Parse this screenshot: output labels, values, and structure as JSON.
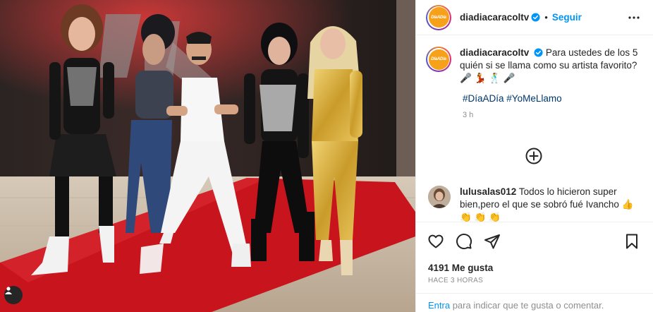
{
  "header": {
    "username": "diadiacaracoltv",
    "follow_label": "Seguir",
    "separator": "•",
    "logo_text": "DíaADía"
  },
  "caption": {
    "username": "diadiacaracoltv",
    "text": "Para ustedes de los 5 quién si se llama como su artista favorito? 🎤 💃 🕺 🎤",
    "hashtags": [
      "#DíaADía",
      "#YoMeLlamo"
    ],
    "time": "3 h"
  },
  "comment": {
    "username": "lulusalas012",
    "text": "Todos lo hicieron super bien,pero el que se sobró fué Ivancho 👍 👏 👏 👏"
  },
  "actions": {
    "likes": "4191 Me gusta",
    "posted_ago": "HACE 3 HORAS"
  },
  "login_prompt": {
    "link": "Entra",
    "rest": " para indicar que te gusta o comentar."
  },
  "colors": {
    "accent_blue": "#0095f6",
    "hashtag_blue": "#00376b",
    "logo_orange": "#f7a11a",
    "red_carpet": "#c8141c",
    "gold_outfit": "#d8b13a"
  },
  "icons": [
    "more-options-icon",
    "verified-badge-icon",
    "add-circle-icon",
    "heart-icon",
    "comment-icon",
    "share-icon",
    "bookmark-icon",
    "user-tag-icon"
  ]
}
